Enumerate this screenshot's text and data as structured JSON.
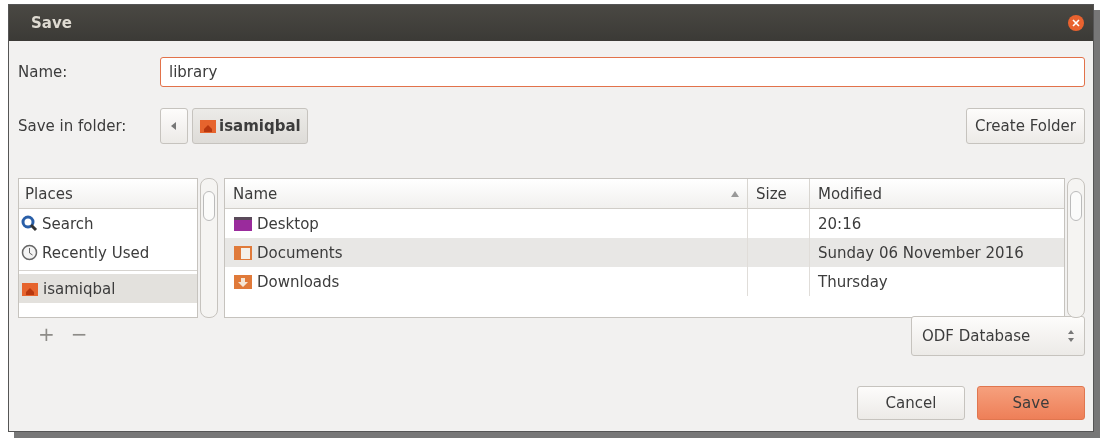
{
  "window": {
    "title": "Save"
  },
  "name_field": {
    "label": "Name:",
    "value": "library"
  },
  "folder": {
    "label": "Save in folder:",
    "crumb": "isamiqbal",
    "create_button": "Create Folder"
  },
  "places": {
    "header": "Places",
    "items": [
      {
        "label": "Search",
        "kind": "search",
        "selected": false
      },
      {
        "label": "Recently Used",
        "kind": "recent",
        "selected": false
      },
      {
        "label": "isamiqbal",
        "kind": "home",
        "selected": true
      }
    ]
  },
  "files": {
    "columns": [
      "Name",
      "Size",
      "Modified"
    ],
    "rows": [
      {
        "name": "Desktop",
        "kind": "desktop",
        "size": "",
        "modified": "20:16"
      },
      {
        "name": "Documents",
        "kind": "documents",
        "size": "",
        "modified": "Sunday 06 November 2016"
      },
      {
        "name": "Downloads",
        "kind": "downloads",
        "size": "",
        "modified": "Thursday"
      }
    ]
  },
  "add_remove": [
    "+",
    "−"
  ],
  "file_type": "ODF Database",
  "buttons": {
    "cancel": "Cancel",
    "save": "Save"
  }
}
